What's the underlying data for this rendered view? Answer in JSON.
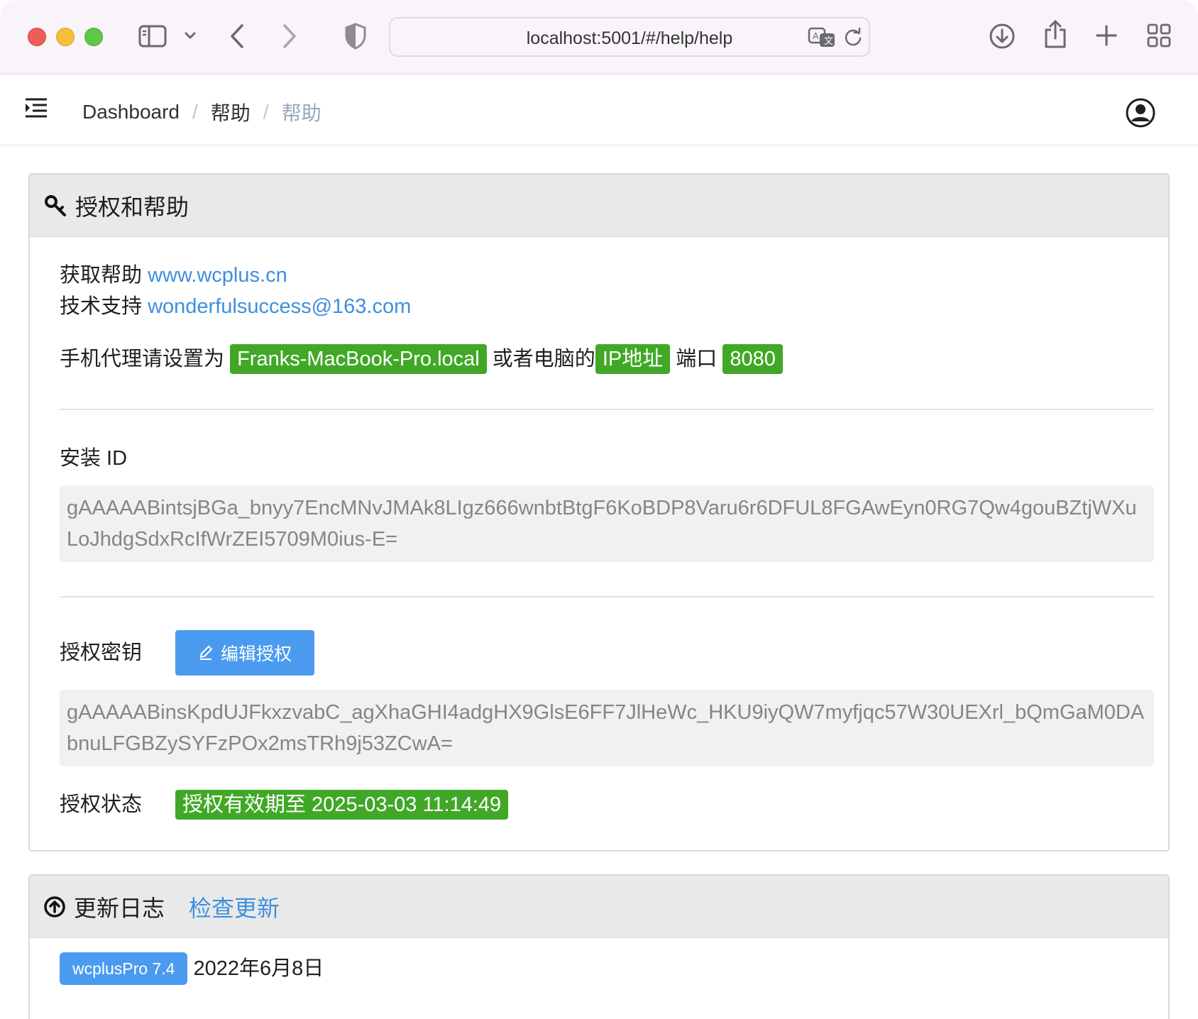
{
  "browser": {
    "url": "localhost:5001/#/help/help"
  },
  "header": {
    "breadcrumb": [
      "Dashboard",
      "帮助",
      "帮助"
    ],
    "separator": "/"
  },
  "auth_panel": {
    "title": "授权和帮助",
    "help_label": "获取帮助",
    "help_link": "www.wcplus.cn",
    "support_label": "技术支持",
    "support_email": "wonderfulsuccess@163.com",
    "proxy_prefix": "手机代理请设置为",
    "proxy_host": "Franks-MacBook-Pro.local",
    "proxy_or": "或者电脑的",
    "proxy_ip_tag": "IP地址",
    "proxy_port_label": "端口",
    "proxy_port": "8080",
    "install_id_label": "安装 ID",
    "install_id": "gAAAAABintsjBGa_bnyy7EncMNvJMAk8LIgz666wnbtBtgF6KoBDP8Varu6r6DFUL8FGAwEyn0RG7Qw4gouBZtjWXuLoJhdgSdxRcIfWrZEI5709M0ius-E=",
    "license_key_label": "授权密钥",
    "edit_button": "编辑授权",
    "license_key": "gAAAAABinsKpdUJFkxzvabC_agXhaGHI4adgHX9GlsE6FF7JlHeWc_HKU9iyQW7myfjqc57W30UEXrl_bQmGaM0DAbnuLFGBZySYFzPOx2msTRh9j53ZCwA=",
    "status_label": "授权状态",
    "status_value": "授权有效期至 2025-03-03 11:14:49"
  },
  "update_panel": {
    "title": "更新日志",
    "check_link": "检查更新",
    "version": "wcplusPro 7.4",
    "date": "2022年6月8日"
  },
  "colors": {
    "link": "#3f8fde",
    "success_tag": "#41a827",
    "primary_button": "#4a9bf0"
  }
}
